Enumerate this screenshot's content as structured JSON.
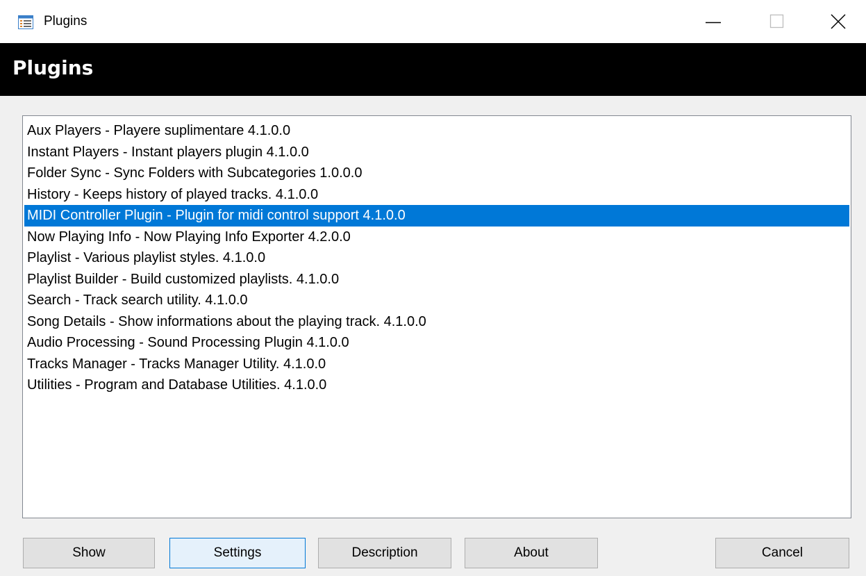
{
  "window": {
    "title": "Plugins",
    "app_icon": "list-window-icon",
    "controls": [
      "minimize-icon",
      "maximize-icon",
      "close-icon"
    ]
  },
  "header": {
    "title": "Plugins",
    "background": "#000000",
    "color": "#ffffff"
  },
  "plugins": {
    "selected_index": 4,
    "selection_color": "#0078d7",
    "items": [
      "Aux Players - Playere suplimentare 4.1.0.0",
      "Instant Players - Instant players plugin 4.1.0.0",
      "Folder Sync - Sync Folders with Subcategories 1.0.0.0",
      "History - Keeps history of played tracks. 4.1.0.0",
      "MIDI Controller Plugin - Plugin for midi control support 4.1.0.0",
      "Now Playing Info - Now Playing Info Exporter 4.2.0.0",
      "Playlist - Various playlist styles. 4.1.0.0",
      "Playlist Builder - Build customized playlists. 4.1.0.0",
      "Search - Track search utility. 4.1.0.0",
      "Song Details - Show informations about the playing track. 4.1.0.0",
      "Audio Processing - Sound Processing Plugin 4.1.0.0",
      "Tracks Manager - Tracks Manager Utility. 4.1.0.0",
      "Utilities - Program and Database Utilities. 4.1.0.0"
    ]
  },
  "buttons": {
    "show": "Show",
    "settings": "Settings",
    "description": "Description",
    "about": "About",
    "cancel": "Cancel"
  }
}
